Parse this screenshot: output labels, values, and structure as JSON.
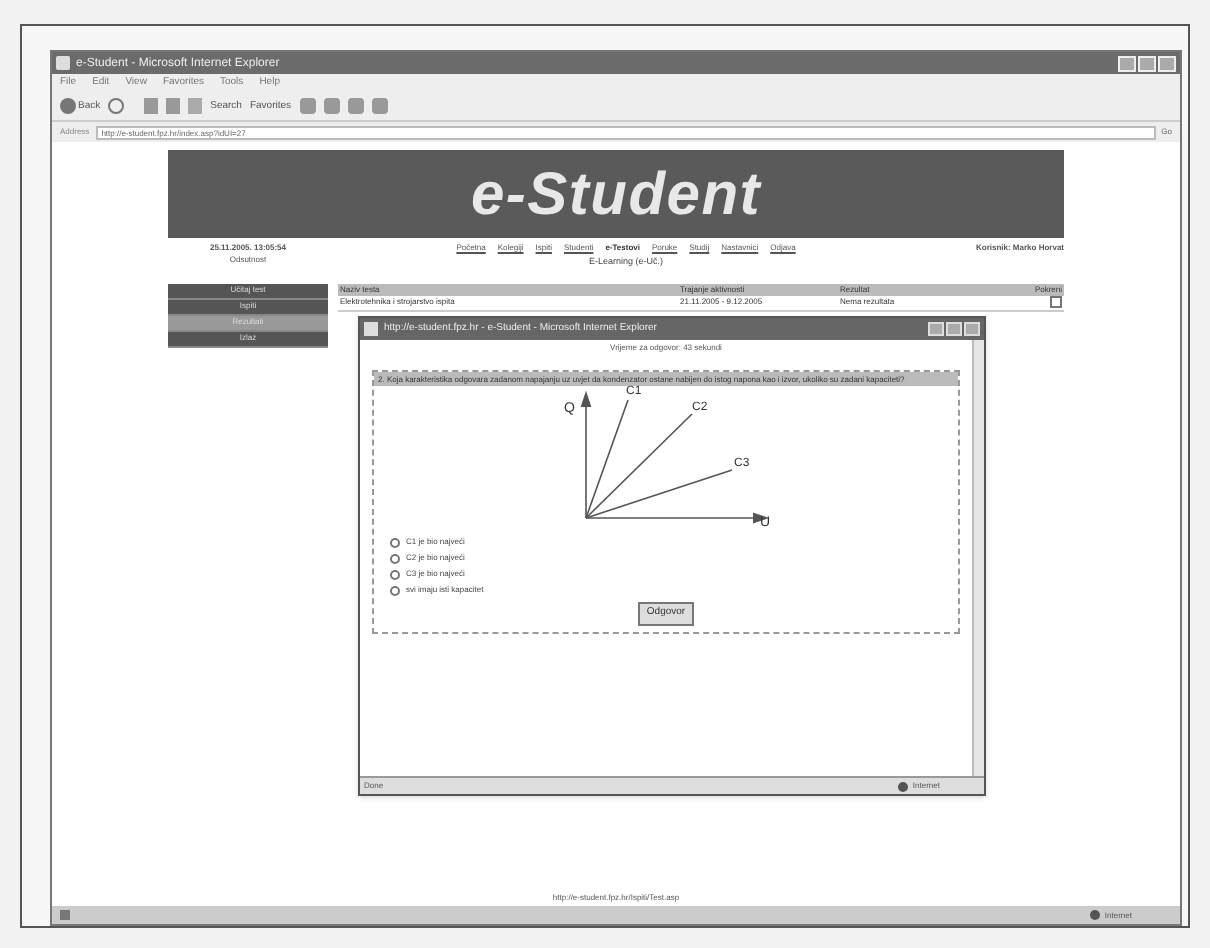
{
  "window": {
    "title": "e-Student - Microsoft Internet Explorer"
  },
  "menu": [
    "File",
    "Edit",
    "View",
    "Favorites",
    "Tools",
    "Help"
  ],
  "toolbar": [
    "Back",
    "Search",
    "Favorites"
  ],
  "address": {
    "label": "Address",
    "url": "http://e-student.fpz.hr/index.asp?idUI=27",
    "go": "Go"
  },
  "banner": {
    "title": "e-Student"
  },
  "header": {
    "datetime": "25.11.2005. 13:05:54",
    "role": "Odsutnost",
    "user": "Korisnik: Marko Horvat"
  },
  "nav": [
    {
      "label": "Početna",
      "selected": false
    },
    {
      "label": "Kolegiji",
      "selected": false
    },
    {
      "label": "Ispiti",
      "selected": false
    },
    {
      "label": "Studenti",
      "selected": false
    },
    {
      "label": "e-Testovi",
      "selected": true
    },
    {
      "label": "Poruke",
      "selected": false
    },
    {
      "label": "Studij",
      "selected": false
    },
    {
      "label": "Nastavnici",
      "selected": false
    },
    {
      "label": "Odjava",
      "selected": false
    }
  ],
  "section": "E-Learning (e-Uč.)",
  "side_menu": [
    {
      "label": "Učitaj test",
      "selected": false
    },
    {
      "label": "Ispiti",
      "selected": false
    },
    {
      "label": "Rezultati",
      "selected": true
    },
    {
      "label": "Izlaz",
      "selected": false
    }
  ],
  "table": {
    "columns": [
      "Naziv testa",
      "Trajanje aktivnosti",
      "Rezultat",
      "Pokreni"
    ],
    "rows": [
      [
        "Elektrotehnika i strojarstvo ispita",
        "21.11.2005 - 9.12.2005",
        "Nema rezultata"
      ]
    ]
  },
  "dialog": {
    "title": "http://e-student.fpz.hr - e-Student - Microsoft Internet Explorer",
    "timer": "Vrijeme za odgovor: 43 sekundi",
    "question": "2. Koja karakteristika odgovara zadanom napajanju uz uvjet da kondenzator ostane nabijen do istog napona kao i izvor, ukoliko su zadani kapaciteti?",
    "figure_labels": {
      "y": "Q",
      "x": "U",
      "lines": [
        "C1",
        "C2",
        "C3"
      ]
    },
    "options": [
      {
        "label": "C1 je bio najveći",
        "selected": false
      },
      {
        "label": "C2 je bio najveći",
        "selected": false
      },
      {
        "label": "C3 je bio najveći",
        "selected": false
      },
      {
        "label": "svi imaju isti kapacitet",
        "selected": false
      }
    ],
    "button": "Odgovor",
    "status": "Done",
    "zone": "Internet"
  },
  "status_bar": {
    "link": "http://e-student.fpz.hr/Ispiti/Test.asp",
    "zone": "Internet"
  }
}
